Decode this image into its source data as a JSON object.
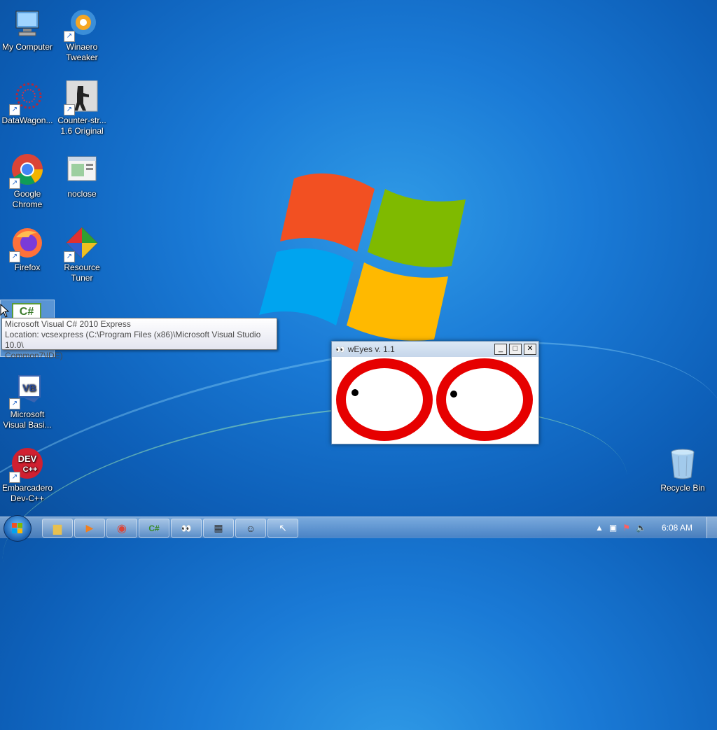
{
  "desktop": {
    "icons": [
      {
        "label": "My Computer",
        "icon": "computer-icon"
      },
      {
        "label": "Winaero Tweaker",
        "icon": "winaero-icon"
      },
      {
        "label": "DataWagon...",
        "icon": "datawagon-icon"
      },
      {
        "label": "Counter-str... 1.6 Original",
        "icon": "counter-strike-icon"
      },
      {
        "label": "Google Chrome",
        "icon": "chrome-icon"
      },
      {
        "label": "noclose",
        "icon": "noclose-icon"
      },
      {
        "label": "Firefox",
        "icon": "firefox-icon"
      },
      {
        "label": "Resource Tuner",
        "icon": "resource-tuner-icon"
      },
      {
        "label": "Microsoft Visual Basi...",
        "icon": "visual-basic-icon"
      },
      {
        "label": "Embarcadero Dev-C++",
        "icon": "devcpp-icon"
      },
      {
        "label": "Recycle Bin",
        "icon": "recycle-bin-icon"
      }
    ],
    "vb_badge": "VB",
    "dev_badge_top": "DEV",
    "dev_badge_bottom": "C++",
    "cs_badge": "C#"
  },
  "tooltip": {
    "line1": "Microsoft Visual C# 2010 Express",
    "line2": "Location: vcsexpress (C:\\Program Files (x86)\\Microsoft Visual Studio 10.0\\",
    "line3": "Common7\\IDE)"
  },
  "weyes": {
    "title": "wEyes v. 1.1",
    "minimize": "_",
    "maximize": "□",
    "close": "✕"
  },
  "taskbar": {
    "buttons": [
      "explorer-icon",
      "media-player-icon",
      "chrome-icon",
      "csharp-icon",
      "weyes-icon",
      "calculator-icon",
      "avatar-icon",
      "cursor-tool-icon"
    ],
    "clock": "6:08 AM"
  },
  "colors": {
    "eye_ring": "#e60000",
    "desktop_blue": "#1a7ad6"
  }
}
